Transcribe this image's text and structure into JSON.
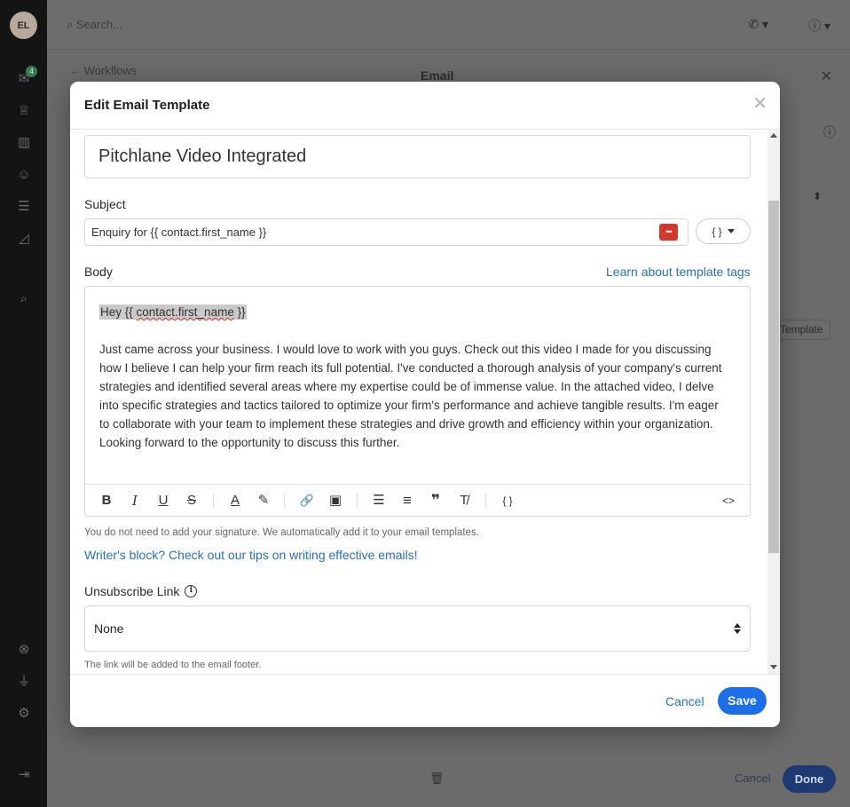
{
  "background": {
    "avatar_initials": "EL",
    "notification_count": "4",
    "search_placeholder": "Search...",
    "breadcrumb": "Workflows",
    "panel_title": "Email",
    "template_button": "Template",
    "cancel_label": "Cancel",
    "done_label": "Done"
  },
  "modal": {
    "title": "Edit Email Template",
    "template_name": "Pitchlane Video Integrated",
    "subject_label": "Subject",
    "subject_value": "Enquiry for {{ contact.first_name }}",
    "tag_dropdown_label": "{ }",
    "body_label": "Body",
    "learn_link": "Learn about template tags",
    "body": {
      "greeting_prefix": "Hey {{ ",
      "greeting_tag": "contact.first_name",
      "greeting_suffix": " }}",
      "paragraph": "Just came across your business. I would love to work with you guys. Check out this video I made for you discussing how I believe I can help your firm reach its full potential. I've conducted a thorough analysis of your company's current strategies and identified several areas where my expertise could be of immense value. In the attached video, I delve into specific strategies and tactics tailored to optimize your firm's performance and achieve tangible results. I'm eager to collaborate with your team to implement these strategies and drive growth and efficiency within your organization. Looking forward to the opportunity to discuss this further."
    },
    "toolbar": {
      "bold": "B",
      "italic": "I",
      "underline": "U",
      "strike": "S",
      "text_color": "A",
      "highlight": "✎",
      "link": "🔗",
      "image": "▣",
      "bullet_list": "☰",
      "ordered_list": "≡",
      "quote": "❞",
      "clear_format": "T̸",
      "template_tags": "{ }",
      "source_code": "<>"
    },
    "signature_hint": "You do not need to add your signature. We automatically add it to your email templates.",
    "writers_block_link": "Writer's block? Check out our tips on writing effective emails!",
    "unsubscribe_label": "Unsubscribe Link",
    "unsubscribe_value": "None",
    "unsubscribe_hint": "The link will be added to the email footer.",
    "cancel_label": "Cancel",
    "save_label": "Save"
  },
  "colors": {
    "primary": "#1d6ee9",
    "link": "#2871b8",
    "password_manager": "#d0392b"
  }
}
